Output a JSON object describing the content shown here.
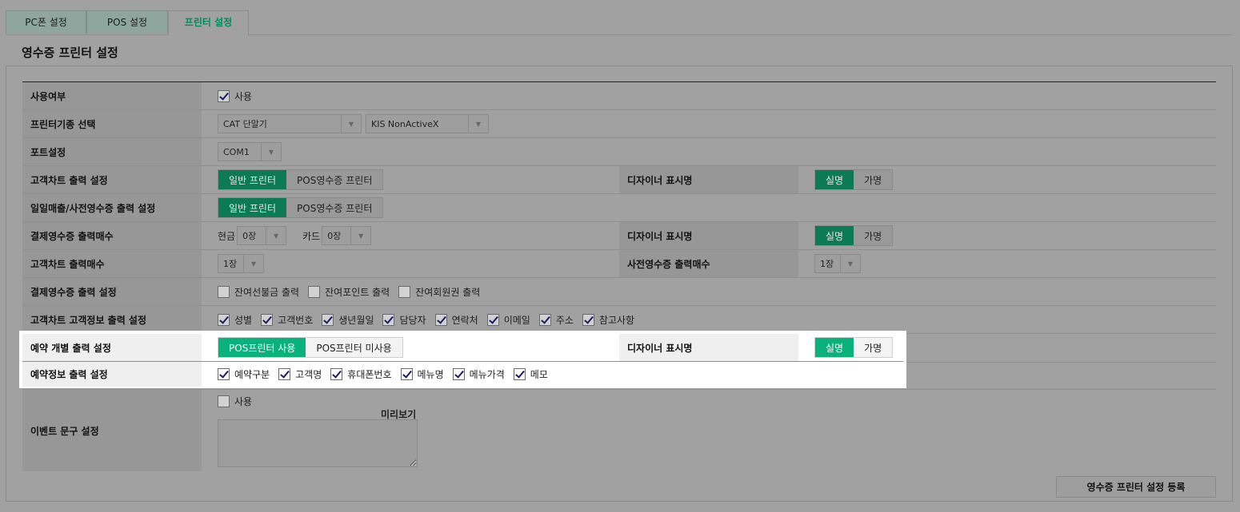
{
  "tabs": [
    "PC폰 설정",
    "POS 설정",
    "프린터 설정"
  ],
  "section_title": "영수증 프린터 설정",
  "rows": {
    "use": {
      "label": "사용여부",
      "checkbox": "사용"
    },
    "printer_type": {
      "label": "프린터기종 선택",
      "select1": "CAT 단말기",
      "select2": "KIS NonActiveX"
    },
    "port": {
      "label": "포트설정",
      "select": "COM1"
    },
    "chart_output": {
      "label": "고객차트 출력 설정",
      "opt1": "일반 프린터",
      "opt2": "POS영수증 프린터",
      "right_label": "디자이너 표시명",
      "r1": "실명",
      "r2": "가명"
    },
    "daily_output": {
      "label": "일일매출/사전영수증 출력 설정",
      "opt1": "일반 프린터",
      "opt2": "POS영수증 프린터"
    },
    "receipt_count": {
      "label": "결제영수증 출력매수",
      "cash_label": "현금",
      "cash_value": "0장",
      "card_label": "카드",
      "card_value": "0장",
      "right_label": "디자이너 표시명",
      "r1": "실명",
      "r2": "가명"
    },
    "chart_count": {
      "label": "고객차트 출력매수",
      "value": "1장",
      "right_label": "사전영수증 출력매수",
      "right_value": "1장"
    },
    "receipt_setting": {
      "label": "결제영수증 출력 설정",
      "items": [
        "잔여선불금 출력",
        "잔여포인트 출력",
        "잔여회원권 출력"
      ]
    },
    "chart_customer": {
      "label": "고객차트 고객정보 출력 설정",
      "items": [
        "성별",
        "고객번호",
        "생년월일",
        "담당자",
        "연락처",
        "이메일",
        "주소",
        "참고사항"
      ]
    },
    "reservation_individual": {
      "label": "예약 개별 출력 설정",
      "opt1": "POS프린터 사용",
      "opt2": "POS프린터 미사용",
      "right_label": "디자이너 표시명",
      "r1": "실명",
      "r2": "가명"
    },
    "reservation_info": {
      "label": "예약정보 출력 설정",
      "items": [
        "예약구분",
        "고객명",
        "휴대폰번호",
        "메뉴명",
        "메뉴가격",
        "메모"
      ]
    },
    "event": {
      "label": "이벤트 문구 설정",
      "checkbox": "사용",
      "preview": "미리보기"
    }
  },
  "register_button": "영수증 프린터 설정 등록"
}
